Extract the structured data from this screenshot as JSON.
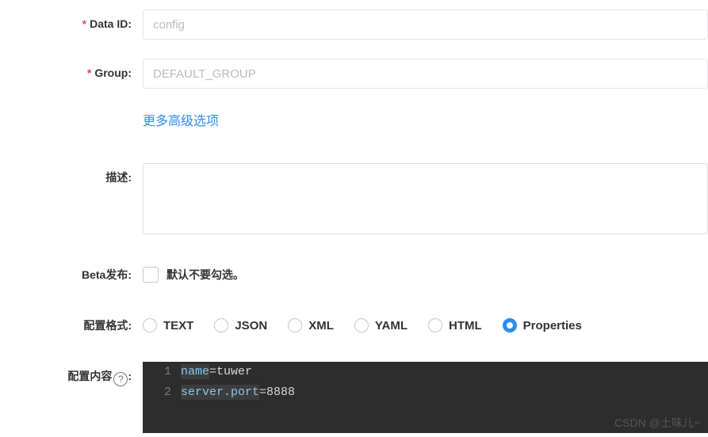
{
  "form": {
    "dataId": {
      "label": "Data ID:",
      "placeholder": "config",
      "value": ""
    },
    "group": {
      "label": "Group:",
      "placeholder": "DEFAULT_GROUP",
      "value": ""
    },
    "advancedLink": "更多高级选项",
    "desc": {
      "label": "描述:",
      "value": ""
    },
    "beta": {
      "label": "Beta发布:",
      "checkboxLabel": "默认不要勾选。",
      "checked": false
    },
    "format": {
      "label": "配置格式:",
      "options": [
        "TEXT",
        "JSON",
        "XML",
        "YAML",
        "HTML",
        "Properties"
      ],
      "selected": "Properties"
    },
    "content": {
      "label": "配置内容",
      "lines": [
        {
          "n": "1",
          "key": "name",
          "val": "tuwer"
        },
        {
          "n": "2",
          "key": "server.port",
          "val": "8888"
        }
      ]
    }
  },
  "watermark": "CSDN @土味儿~"
}
